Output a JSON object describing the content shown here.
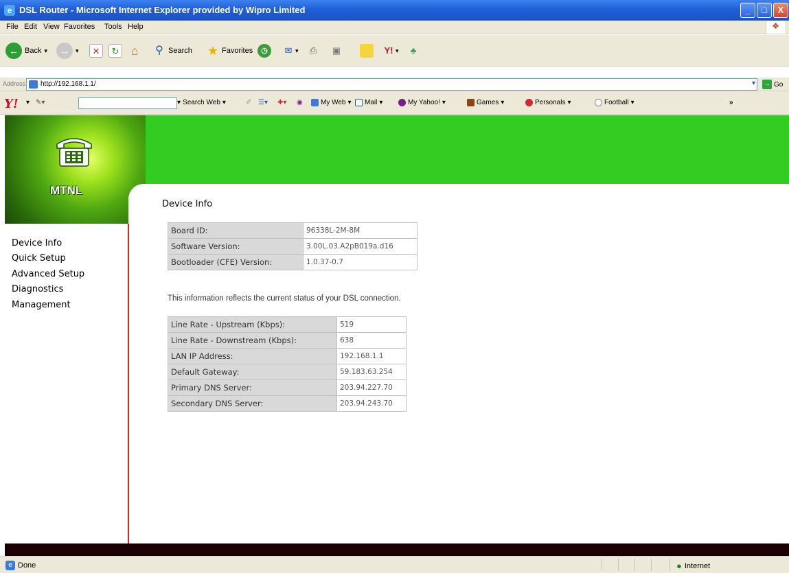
{
  "window": {
    "title": "DSL Router - Microsoft Internet Explorer provided by Wipro Limited",
    "controls": [
      "_",
      "□",
      "X"
    ]
  },
  "menu": [
    "File",
    "Edit",
    "View",
    "Favorites",
    "Tools",
    "Help"
  ],
  "toolbar": {
    "back": "Back",
    "search": "Search",
    "favorites": "Favorites"
  },
  "address": {
    "label": "Address",
    "url": "http://192.168.1.1/",
    "go": "Go"
  },
  "yahoo_toolbar": {
    "search_web": "Search Web",
    "my_web": "My Web",
    "mail": "Mail",
    "my_yahoo": "My Yahoo!",
    "games": "Games",
    "personals": "Personals",
    "football": "Football",
    "more": "»"
  },
  "brand": "MTNL",
  "nav": [
    "Device Info",
    "Quick Setup",
    "Advanced Setup",
    "Diagnostics",
    "Management"
  ],
  "page": {
    "heading": "Device Info",
    "device_table": [
      {
        "label": "Board ID:",
        "value": "96338L-2M-8M"
      },
      {
        "label": "Software Version:",
        "value": "3.00L.03.A2pB019a.d16"
      },
      {
        "label": "Bootloader (CFE) Version:",
        "value": "1.0.37-0.7"
      }
    ],
    "note": "This information reflects the current status of your DSL connection.",
    "status_table": [
      {
        "label": "Line Rate - Upstream (Kbps):",
        "value": "519"
      },
      {
        "label": "Line Rate - Downstream (Kbps):",
        "value": "638"
      },
      {
        "label": "LAN IP Address:",
        "value": "192.168.1.1"
      },
      {
        "label": "Default Gateway:",
        "value": "59.183.63.254"
      },
      {
        "label": "Primary DNS Server:",
        "value": "203.94.227.70"
      },
      {
        "label": "Secondary DNS Server:",
        "value": "203.94.243.70"
      }
    ]
  },
  "statusbar": {
    "left": "Done",
    "zone": "Internet"
  },
  "colors": {
    "titlebar": "#1f5fd6",
    "green_band": "#33cc22",
    "sidebar_border": "#d2272d"
  }
}
